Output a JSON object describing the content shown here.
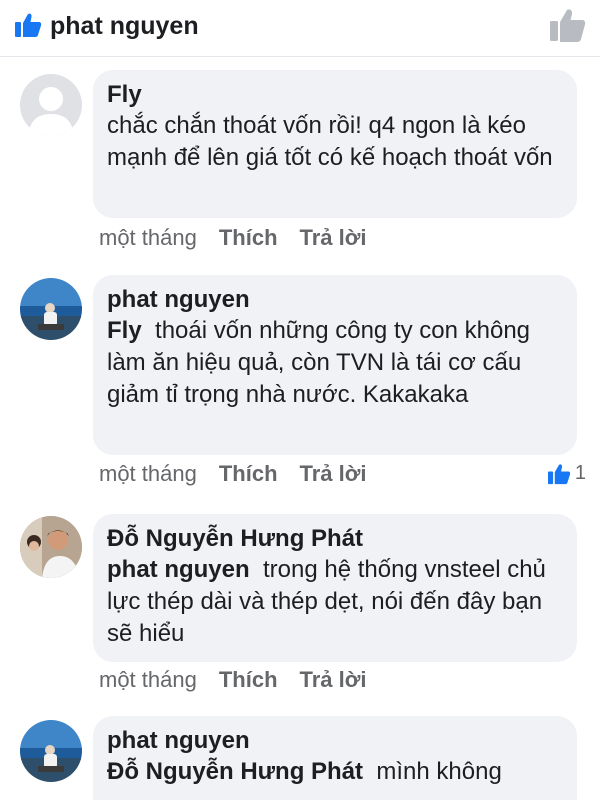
{
  "header": {
    "title": "phat nguyen"
  },
  "colors": {
    "accent": "#1877f2",
    "bubble": "#f0f2f5",
    "meta": "#65676b"
  },
  "comments": [
    {
      "author": "Fly",
      "mention": "",
      "text": "chắc chắn thoát vốn rồi! q4 ngon là kéo mạnh để lên giá tốt có kế hoạch thoát vốn",
      "time": "một tháng",
      "like_label": "Thích",
      "reply_label": "Trả lời",
      "avatar_icon": "default-avatar-icon"
    },
    {
      "author": "phat nguyen",
      "mention": "Fly",
      "text": "thoái vốn những công ty con không làm ăn hiệu quả, còn TVN là tái cơ cấu giảm tỉ trọng nhà nước. Kakakaka",
      "time": "một tháng",
      "like_label": "Thích",
      "reply_label": "Trả lời",
      "reaction_count": "1",
      "avatar_icon": "user-photo-avatar"
    },
    {
      "author": "Đỗ Nguyễn Hưng Phát",
      "mention": "phat nguyen",
      "text": "trong hệ thống vnsteel chủ lực thép dài và thép dẹt, nói đến đây bạn sẽ hiểu",
      "time": "một tháng",
      "like_label": "Thích",
      "reply_label": "Trả lời",
      "avatar_icon": "user-photo-avatar"
    },
    {
      "author": "phat nguyen",
      "mention": "Đỗ Nguyễn Hưng Phát",
      "text": "mình không",
      "avatar_icon": "user-photo-avatar"
    }
  ]
}
